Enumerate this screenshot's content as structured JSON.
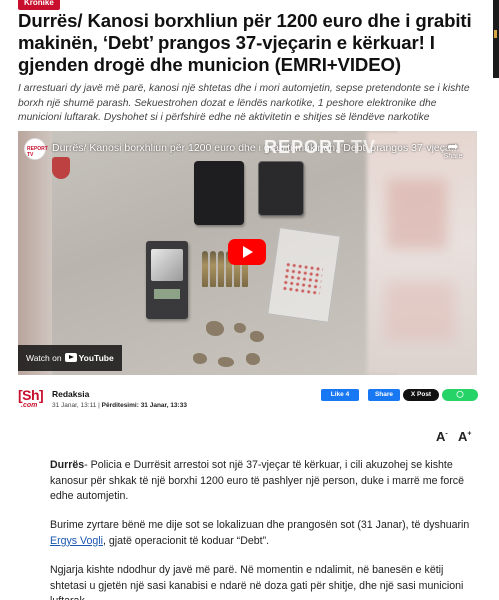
{
  "category": "Kronike",
  "article": {
    "title": "Durrës/ Kanosi borxhliun për 1200 euro dhe i grabiti makinën, ‘Debt’ prangos 37-vjeçarin e kërkuar! I gjenden drogë dhe municion (EMRI+VIDEO)",
    "summary": "I arrestuari dy javë më parë, kanosi një shtetas dhe i mori automjetin, sepse pretendonte se i kishte borxh një shumë parash. Sekuestrohen dozat e lëndës narkotike, 1 peshore elektronike dhe municioni luftarak. Dyshohet si i përfshirë edhe në aktivitetin e shitjes së lëndëve narkotike"
  },
  "video": {
    "channel_badge": "REPORT TV",
    "title": "Durrës/ Kanosi borxhliun për 1200 euro dhe i grabiti makinën, ‘Debt’ prangos 37-vjeça...",
    "watermark_main": "REPORT",
    "watermark_tv": "TV",
    "share_label": "Share",
    "watch_on_label": "Watch on",
    "youtube_label": "YouTube"
  },
  "byline": {
    "logo_main": "[Sh]",
    "logo_sub": ".com",
    "author": "Redaksia",
    "published": "31 Janar, 13:11",
    "updated_label": "Përditesimi:",
    "updated": "31 Janar, 13:33"
  },
  "social": {
    "like": "Like 4",
    "share": "Share",
    "post": "X Post",
    "whatsapp": "◯"
  },
  "font_controls": {
    "decrease": "A",
    "increase": "A",
    "minus": "-",
    "plus": "+"
  },
  "body": {
    "p1_lead": "Durrës",
    "p1_rest": "- Policia e Durrësit arrestoi sot një 37-vjeçar të kërkuar, i cili akuzohej se kishte kanosur për shkak të një borxhi 1200 euro të pashlyer një person, duke i marrë me forcë edhe automjetin.",
    "p2_before": "Burime zyrtare bënë me dije sot se lokalizuan dhe prangosën sot (31 Janar), të dyshuarin ",
    "p2_link": "Ergys Vogli",
    "p2_after": ", gjatë operacionit të koduar “Debt”.",
    "p3": "Ngjarja kishte ndodhur dy javë më parë. Në momentin e ndalimit, në banesën e këtij shtetasi u gjetën një sasi kanabisi e ndarë në doza gati për shitje, dhe një sasi municioni luftarak."
  },
  "colors": {
    "brand_red": "#c8102e",
    "facebook_blue": "#1877f2",
    "whatsapp_green": "#25d366",
    "link_blue": "#1a56b0"
  }
}
